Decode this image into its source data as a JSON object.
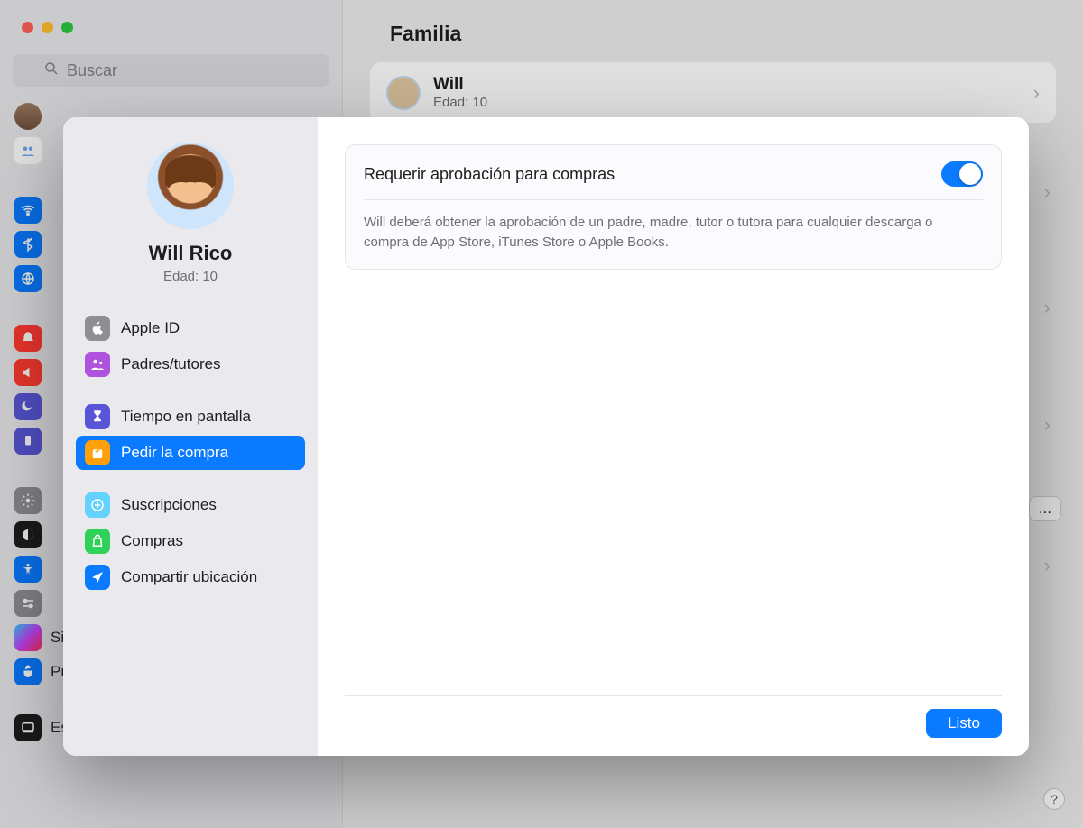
{
  "bg": {
    "search_placeholder": "Buscar",
    "title": "Familia",
    "member": {
      "name": "Will",
      "age_label": "Edad: 10"
    },
    "side_items": [
      {
        "label": "Siri y Spotlight"
      },
      {
        "label": "Privacidad y seguridad"
      },
      {
        "label": "Escritorio y Dock"
      }
    ],
    "ellipsis_button": "..."
  },
  "sheet": {
    "name": "Will Rico",
    "age_label": "Edad: 10",
    "menu": [
      {
        "label": "Apple ID",
        "color": "#8e8e93",
        "selected": false
      },
      {
        "label": "Padres/tutores",
        "color": "#af52de",
        "selected": false
      },
      {
        "label": "Tiempo en pantalla",
        "color": "#5856d6",
        "selected": false
      },
      {
        "label": "Pedir la compra",
        "color": "#ff9f0a",
        "selected": true
      },
      {
        "label": "Suscripciones",
        "color": "#64d2ff",
        "selected": false
      },
      {
        "label": "Compras",
        "color": "#30d158",
        "selected": false
      },
      {
        "label": "Compartir ubicación",
        "color": "#0a7aff",
        "selected": false
      }
    ],
    "panel": {
      "title": "Requerir aprobación para compras",
      "description": "Will deberá obtener la aprobación de un padre, madre, tutor o tutora para cualquier descarga o compra de App Store, iTunes Store o Apple Books.",
      "toggle_on": true
    },
    "done": "Listo"
  },
  "help": "?"
}
